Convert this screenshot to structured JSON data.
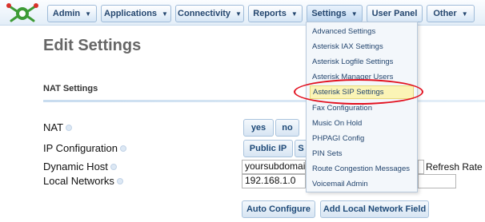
{
  "nav": {
    "items": [
      {
        "label": "Admin",
        "has_caret": true
      },
      {
        "label": "Applications",
        "has_caret": true
      },
      {
        "label": "Connectivity",
        "has_caret": true
      },
      {
        "label": "Reports",
        "has_caret": true
      },
      {
        "label": "Settings",
        "has_caret": true
      },
      {
        "label": "User Panel",
        "has_caret": false
      },
      {
        "label": "Other",
        "has_caret": true
      }
    ],
    "active": "Settings"
  },
  "page": {
    "title": "Edit Settings",
    "section": "NAT Settings"
  },
  "form": {
    "nat_label": "NAT",
    "nat_yes": "yes",
    "nat_no": "no",
    "ip_config_label": "IP Configuration",
    "ip_public": "Public IP",
    "ip_static_partial": "S",
    "dynamic_host_label": "Dynamic Host",
    "dynamic_host_value": "yoursubdomain",
    "refresh_rate_label": "Refresh Rate",
    "local_networks_label": "Local Networks",
    "local_network_value": "192.168.1.0",
    "auto_configure": "Auto Configure",
    "add_local_network": "Add Local Network Field"
  },
  "settings_menu": {
    "items": [
      "Advanced Settings",
      "Asterisk IAX Settings",
      "Asterisk Logfile Settings",
      "Asterisk Manager Users",
      "Asterisk SIP Settings",
      "Fax Configuration",
      "Music On Hold",
      "PHPAGI Config",
      "PIN Sets",
      "Route Congestion Messages",
      "Voicemail Admin"
    ],
    "highlighted": "Asterisk SIP Settings"
  },
  "colors": {
    "nav_text": "#24466f",
    "highlight_ring": "#e2101e",
    "highlight_fill": "#fbf4b6"
  }
}
